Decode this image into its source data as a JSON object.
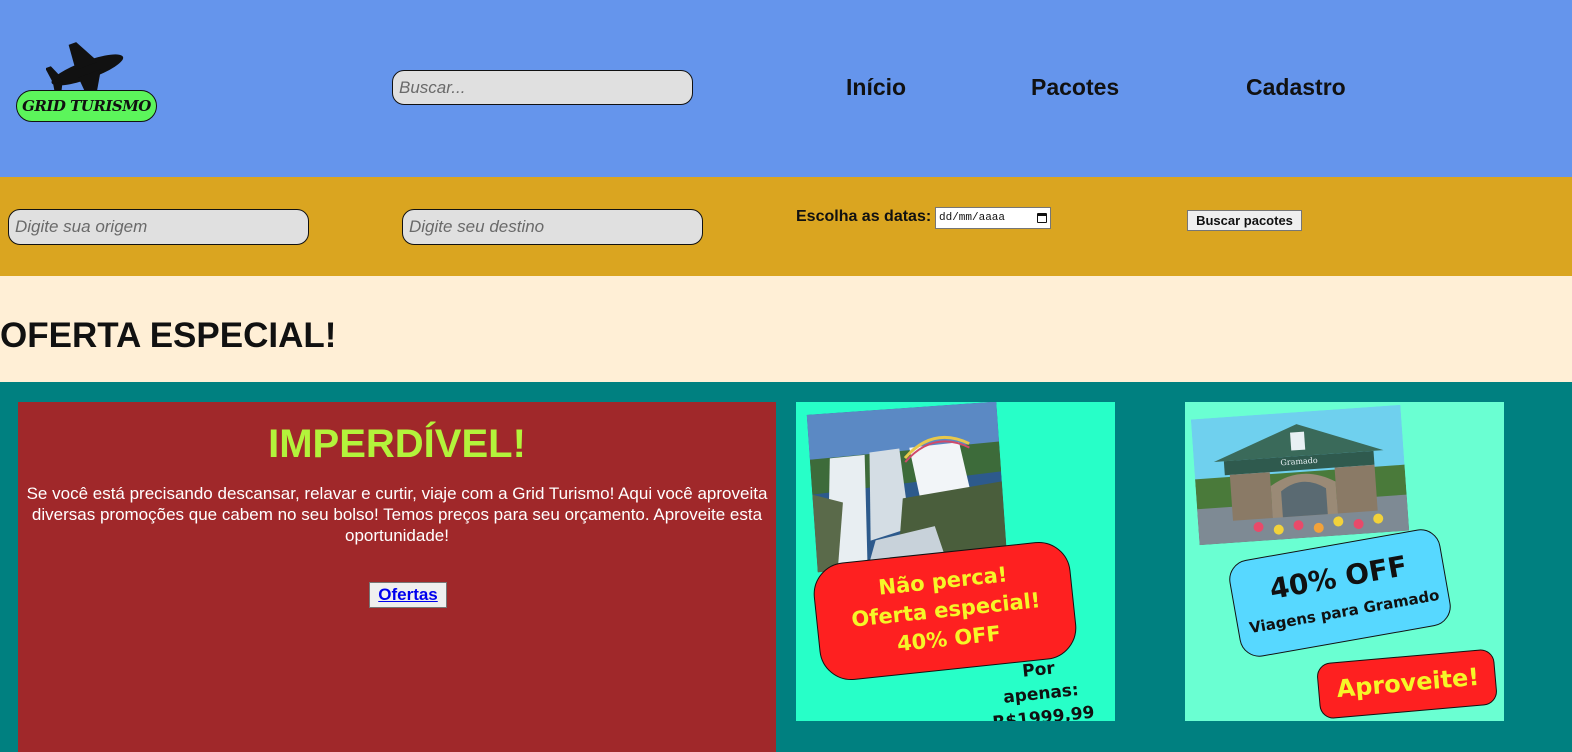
{
  "header": {
    "logo_text": "GRID TURISMO",
    "search_placeholder": "Buscar...",
    "nav": [
      {
        "label": "Início"
      },
      {
        "label": "Pacotes"
      },
      {
        "label": "Cadastro"
      }
    ]
  },
  "search_bar": {
    "origin_placeholder": "Digite sua origem",
    "destination_placeholder": "Digite seu destino",
    "dates_label": "Escolha as datas:",
    "date_value": "dd/mm/aaaa",
    "submit_label": "Buscar pacotes"
  },
  "offer": {
    "title": "OFERTA ESPECIAL!"
  },
  "promo": {
    "title": "IMPERDÍVEL!",
    "text": "Se você está precisando descansar, relavar e curtir, viaje com a Grid Turismo! Aqui você aproveita diversas promoções que cabem no seu bolso! Temos preços para seu orçamento. Aproveite esta oportunidade!",
    "button_label": "Ofertas"
  },
  "card1": {
    "line1": "Não perca!",
    "line2": "Oferta especial!",
    "line3": "40% OFF",
    "price_label": "Por apenas:",
    "price": "R$1999,99"
  },
  "card2": {
    "discount": "40% OFF",
    "subtitle": "Viagens para Gramado",
    "cta": "Aproveite!",
    "sign_text": "Gramado"
  },
  "colors": {
    "header": "#6595ec",
    "search_bar": "#daa520",
    "offer_bg": "#ffefd6",
    "cards_bg": "#008080",
    "promo_bg": "#a0282a",
    "promo_title": "#b3f33b",
    "card1_bg": "#27ffc8",
    "card2_bg": "#6affd2",
    "logo_badge": "#5cf55b"
  }
}
